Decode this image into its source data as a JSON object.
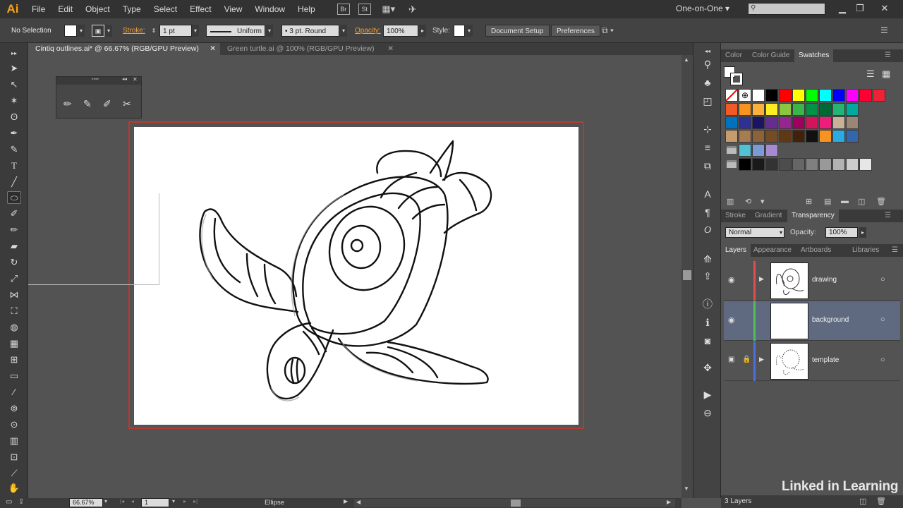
{
  "app": {
    "logo": "Ai"
  },
  "menu": [
    "File",
    "Edit",
    "Object",
    "Type",
    "Select",
    "Effect",
    "View",
    "Window",
    "Help"
  ],
  "menu_icons": [
    "Br",
    "St"
  ],
  "workspace": "One-on-One",
  "control": {
    "selection": "No Selection",
    "stroke_label": "Stroke:",
    "stroke_value": "1 pt",
    "uniform": "Uniform",
    "brush": "3 pt. Round",
    "opacity_label": "Opacity:",
    "opacity_value": "100%",
    "style_label": "Style:",
    "doc_setup": "Document Setup",
    "preferences": "Preferences"
  },
  "tabs": [
    {
      "label": "Cintiq outlines.ai* @ 66.67% (RGB/GPU Preview)",
      "active": true
    },
    {
      "label": "Green turtle.ai @ 100% (RGB/GPU Preview)",
      "active": false
    }
  ],
  "swatches_panel": {
    "tabs": [
      "Color",
      "Color Guide",
      "Swatches"
    ],
    "colors": [
      [
        "#ffffff",
        "#000000",
        "#ff0000",
        "#ffff00",
        "#00ff00",
        "#00ffff",
        "#0000ff",
        "#ff00ff",
        "#ff0033",
        "#ee2233"
      ],
      [
        "#f05a24",
        "#f7931e",
        "#fbb03b",
        "#fcee21",
        "#8cc63f",
        "#39b54a",
        "#009245",
        "#006837",
        "#22b573",
        "#00a99d"
      ],
      [
        "#0071bc",
        "#2e3192",
        "#1b1464",
        "#662d91",
        "#93278f",
        "#9e005d",
        "#d4145a",
        "#ed1e79",
        "#c7b299",
        "#998675"
      ],
      [
        "#c69c6d",
        "#a67c52",
        "#8c6239",
        "#754c24",
        "#603813",
        "#42210b",
        "#111111",
        "#f7931e",
        "#29abe2",
        "#3366aa"
      ],
      [
        "#53c1d4",
        "#7a9bd6",
        "#a58ad0"
      ],
      [
        "#000000",
        "#1a1a1a",
        "#333333",
        "#4d4d4d",
        "#666666",
        "#808080",
        "#999999",
        "#b3b3b3",
        "#cccccc",
        "#e6e6e6"
      ]
    ]
  },
  "transparency_panel": {
    "tabs": [
      "Stroke",
      "Gradient",
      "Transparency"
    ],
    "mode": "Normal",
    "opacity_label": "Opacity:",
    "opacity": "100%"
  },
  "layers_panel": {
    "tabs": [
      "Layers",
      "Appearance",
      "Artboards",
      "Libraries"
    ],
    "layers": [
      {
        "name": "drawing",
        "color": "#e04f4f",
        "selected": false,
        "locked": false
      },
      {
        "name": "background",
        "color": "#4fbf5a",
        "selected": true,
        "locked": false
      },
      {
        "name": "template",
        "color": "#4f6fe0",
        "selected": false,
        "locked": true
      }
    ],
    "count": "3 Layers"
  },
  "status": {
    "zoom": "66.67%",
    "artboard": "1",
    "tool": "Ellipse"
  },
  "watermark": "Linked in Learning"
}
